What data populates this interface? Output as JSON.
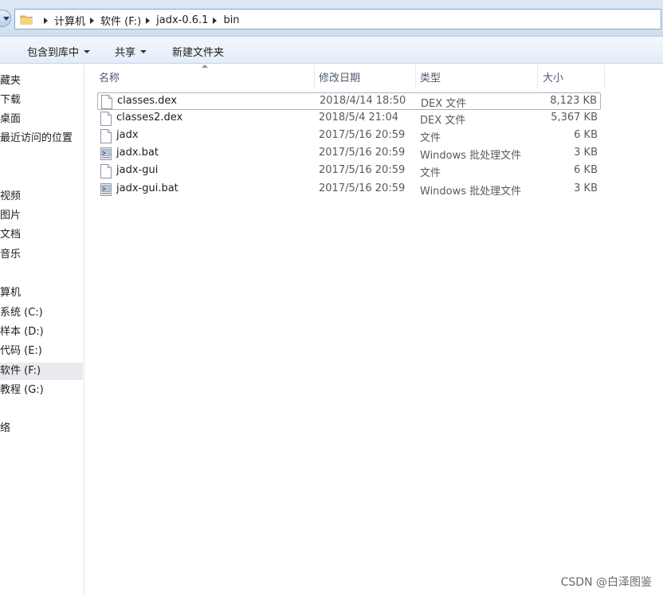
{
  "address_bar": {
    "crumbs": [
      "计算机",
      "软件 (F:)",
      "jadx-0.6.1",
      "bin"
    ]
  },
  "toolbar": {
    "include_library": "包含到库中",
    "share": "共享",
    "new_folder": "新建文件夹"
  },
  "sidebar": {
    "items": [
      "藏夹",
      "下载",
      "桌面",
      "最近访问的位置",
      "视频",
      "图片",
      "文档",
      "音乐",
      "算机",
      "系统 (C:)",
      "样本 (D:)",
      "代码 (E:)",
      "软件 (F:)",
      "教程 (G:)",
      "络"
    ],
    "selected": "软件 (F:)"
  },
  "columns": {
    "name": "名称",
    "date": "修改日期",
    "type": "类型",
    "size": "大小"
  },
  "files": [
    {
      "name": "classes.dex",
      "date": "2018/4/14 18:50",
      "type": "DEX 文件",
      "size": "8,123 KB",
      "icon": "blank-file-icon"
    },
    {
      "name": "classes2.dex",
      "date": "2018/5/4 21:04",
      "type": "DEX 文件",
      "size": "5,367 KB",
      "icon": "blank-file-icon"
    },
    {
      "name": "jadx",
      "date": "2017/5/16 20:59",
      "type": "文件",
      "size": "6 KB",
      "icon": "blank-file-icon"
    },
    {
      "name": "jadx.bat",
      "date": "2017/5/16 20:59",
      "type": "Windows 批处理文件",
      "size": "3 KB",
      "icon": "batch-file-icon"
    },
    {
      "name": "jadx-gui",
      "date": "2017/5/16 20:59",
      "type": "文件",
      "size": "6 KB",
      "icon": "blank-file-icon"
    },
    {
      "name": "jadx-gui.bat",
      "date": "2017/5/16 20:59",
      "type": "Windows 批处理文件",
      "size": "3 KB",
      "icon": "batch-file-icon"
    }
  ],
  "watermark": "CSDN @白泽图鉴"
}
